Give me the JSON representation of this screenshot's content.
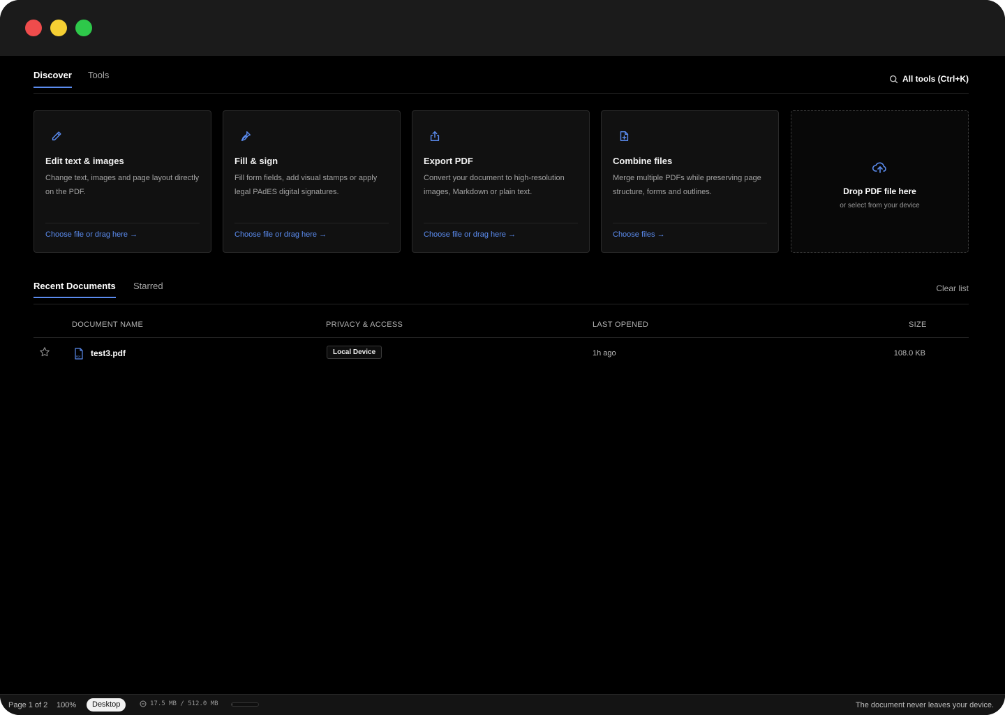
{
  "top_tabs": {
    "discover": "Discover",
    "tools": "Tools"
  },
  "all_tools": {
    "label": "All tools (Ctrl+K)",
    "icon": "search-icon"
  },
  "cards": [
    {
      "title": "Edit text & images",
      "desc": "Change text, images and page layout directly on the PDF.",
      "link": "Choose file or drag here →",
      "icon": "pencil-icon",
      "color": "#5b8cf0"
    },
    {
      "title": "Fill & sign",
      "desc": "Fill form fields, add visual stamps or apply legal PAdES digital signatures.",
      "link": "Choose file or drag here →",
      "icon": "pen-nib-icon",
      "color": "#5b8cf0"
    },
    {
      "title": "Export PDF",
      "desc": "Convert your document to high-resolution images, Markdown or plain text.",
      "link": "Choose file or drag here →",
      "icon": "share-icon",
      "color": "#5b8cf0"
    },
    {
      "title": "Combine files",
      "desc": "Merge multiple PDFs while preserving page structure, forms and outlines.",
      "link": "Choose files →",
      "icon": "file-plus-icon",
      "color": "#5b8cf0"
    }
  ],
  "drop_zone": {
    "title": "Drop PDF file here",
    "subtitle": "or select from your device",
    "icon": "cloud-upload-icon"
  },
  "recent_tabs": {
    "recent": "Recent Documents",
    "starred": "Starred",
    "clear": "Clear list"
  },
  "table": {
    "headers": {
      "name": "DOCUMENT NAME",
      "privacy": "PRIVACY & ACCESS",
      "opened": "LAST OPENED",
      "size": "SIZE"
    },
    "rows": [
      {
        "name": "test3.pdf",
        "privacy": "Local Device",
        "opened": "1h ago",
        "size": "108.0 KB"
      }
    ]
  },
  "status": {
    "page": "Page 1 of 2",
    "zoom": "100%",
    "mode": "Desktop",
    "memory": "17.5 MB / 512.0 MB",
    "memory_fraction": 0.034,
    "privacy_note": "The document never leaves your device."
  },
  "colors": {
    "accent": "#5b8cf0",
    "background": "#000000",
    "titlebar": "#1b1b1b"
  }
}
